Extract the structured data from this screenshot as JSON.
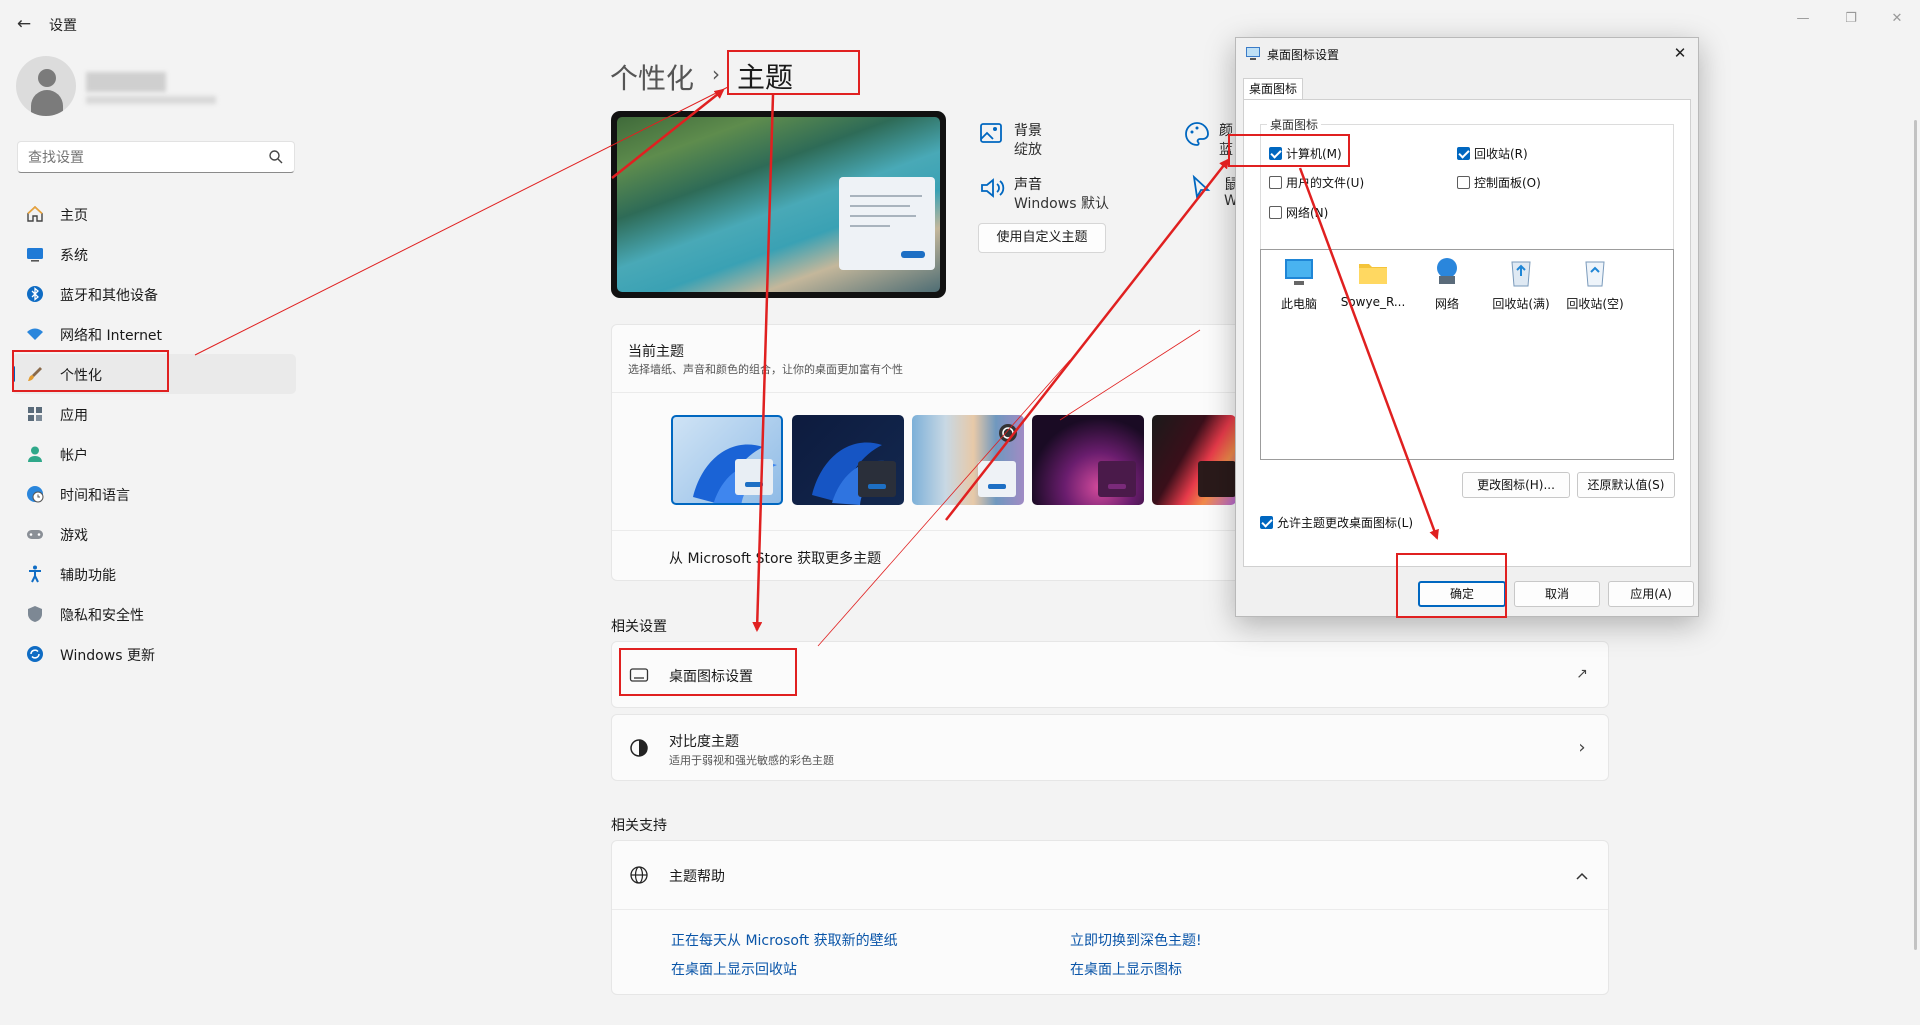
{
  "window": {
    "title": "设置",
    "minimize": "—",
    "maximize": "❐",
    "close": "✕"
  },
  "search": {
    "placeholder": "查找设置"
  },
  "nav": [
    {
      "label": "主页",
      "icon": "home-icon"
    },
    {
      "label": "系统",
      "icon": "monitor-icon"
    },
    {
      "label": "蓝牙和其他设备",
      "icon": "bluetooth-icon"
    },
    {
      "label": "网络和 Internet",
      "icon": "wifi-icon"
    },
    {
      "label": "个性化",
      "icon": "brush-icon",
      "active": true
    },
    {
      "label": "应用",
      "icon": "apps-icon"
    },
    {
      "label": "帐户",
      "icon": "account-icon"
    },
    {
      "label": "时间和语言",
      "icon": "clock-globe-icon"
    },
    {
      "label": "游戏",
      "icon": "gamepad-icon"
    },
    {
      "label": "辅助功能",
      "icon": "accessibility-icon"
    },
    {
      "label": "隐私和安全性",
      "icon": "shield-icon"
    },
    {
      "label": "Windows 更新",
      "icon": "update-icon"
    }
  ],
  "breadcrumb": {
    "parent": "个性化",
    "separator": "›",
    "current": "主题"
  },
  "props": {
    "background": {
      "title": "背景",
      "value": "绽放"
    },
    "color": {
      "title": "颜",
      "value": "蓝"
    },
    "sound": {
      "title": "声音",
      "value": "Windows 默认"
    },
    "cursor": {
      "title": "鼠",
      "value": "W"
    }
  },
  "custom_theme_button": "使用自定义主题",
  "current_theme": {
    "title": "当前主题",
    "subtitle": "选择墙纸、声音和颜色的组合，让你的桌面更加富有个性",
    "store_link": "从 Microsoft Store 获取更多主题"
  },
  "related_settings": {
    "heading": "相关设置",
    "desktop_icons": {
      "title": "桌面图标设置",
      "trailing": "↗"
    },
    "contrast": {
      "title": "对比度主题",
      "subtitle": "适用于弱视和强光敏感的彩色主题",
      "trailing": "›"
    }
  },
  "related_support": {
    "heading": "相关支持",
    "help_title": "主题帮助",
    "links": [
      "正在每天从 Microsoft 获取新的壁纸",
      "立即切换到深色主题!",
      "在桌面上显示回收站",
      "在桌面上显示图标"
    ]
  },
  "dialog": {
    "title": "桌面图标设置",
    "tab": "桌面图标",
    "group_label": "桌面图标",
    "checkboxes": [
      {
        "label": "计算机(M)",
        "checked": true
      },
      {
        "label": "回收站(R)",
        "checked": true
      },
      {
        "label": "用户的文件(U)",
        "checked": false
      },
      {
        "label": "控制面板(O)",
        "checked": false
      },
      {
        "label": "网络(N)",
        "checked": false
      }
    ],
    "icons": [
      "此电脑",
      "Sowye_R...",
      "网络",
      "回收站(满)",
      "回收站(空)"
    ],
    "change_icon": "更改图标(H)...",
    "restore_default": "还原默认值(S)",
    "allow_themes": "允许主题更改桌面图标(L)",
    "allow_themes_checked": true,
    "ok": "确定",
    "cancel": "取消",
    "apply": "应用(A)"
  },
  "colors": {
    "accent": "#005fb8",
    "highlight": "#e02020",
    "link": "#0a55a8"
  }
}
